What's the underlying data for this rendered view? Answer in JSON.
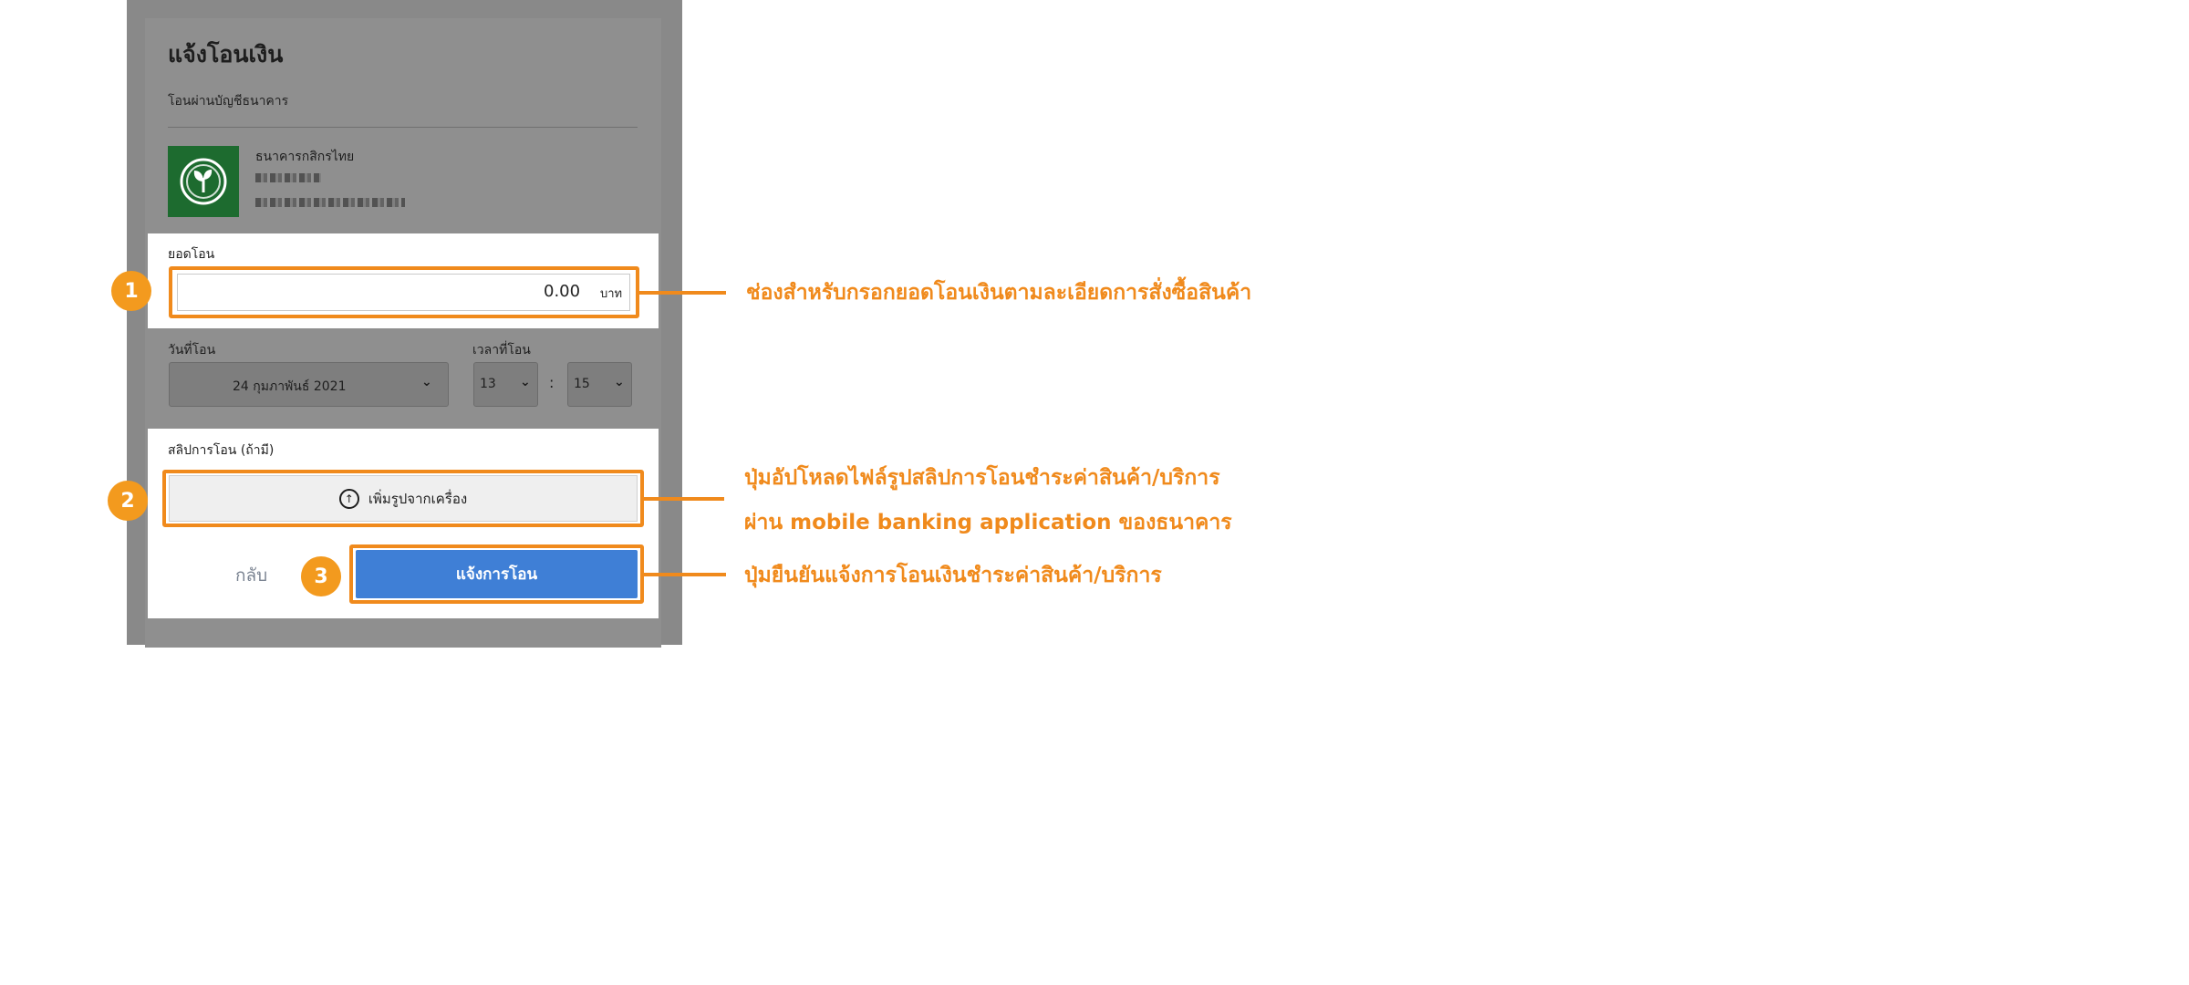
{
  "modal": {
    "title": "แจ้งโอนเงิน",
    "subtitle": "โอนผ่านบัญชีธนาคาร",
    "bank": {
      "name": "ธนาคารกสิกรไทย",
      "logo_icon": "kasikorn-leaf-icon",
      "logo_color": "#1d6b2f"
    },
    "amount": {
      "label": "ยอดโอน",
      "value": "0.00",
      "unit": "บาท"
    },
    "date": {
      "label": "วันที่โอน",
      "value": "24 กุมภาพันธ์ 2021"
    },
    "time": {
      "label": "เวลาที่โอน",
      "hour": "13",
      "minute": "15",
      "separator": ":"
    },
    "slip": {
      "label": "สลิปการโอน (ถ้ามี)",
      "upload_label": "เพิ่มรูปจากเครื่อง",
      "upload_icon": "upload-arrow-icon"
    },
    "back_label": "กลับ",
    "submit_label": "แจ้งการโอน"
  },
  "annotations": {
    "badges": [
      "1",
      "2",
      "3"
    ],
    "note1": "ช่องสำหรับกรอกยอดโอนเงินตามละเอียดการสั่งซื้อสินค้า",
    "note2_line1": "ปุ่มอัปโหลดไฟล์รูปสลิปการโอนชำระค่าสินค้า/บริการ",
    "note2_line2": "ผ่าน mobile banking application ของธนาคาร",
    "note3": "ปุ่มยืนยันแจ้งการโอนเงินชำระค่าสินค้า/บริการ"
  },
  "colors": {
    "highlight": "#f08a1c",
    "badge": "#f39a1e",
    "submit": "#3f7fd6",
    "overlay": "#898989"
  }
}
